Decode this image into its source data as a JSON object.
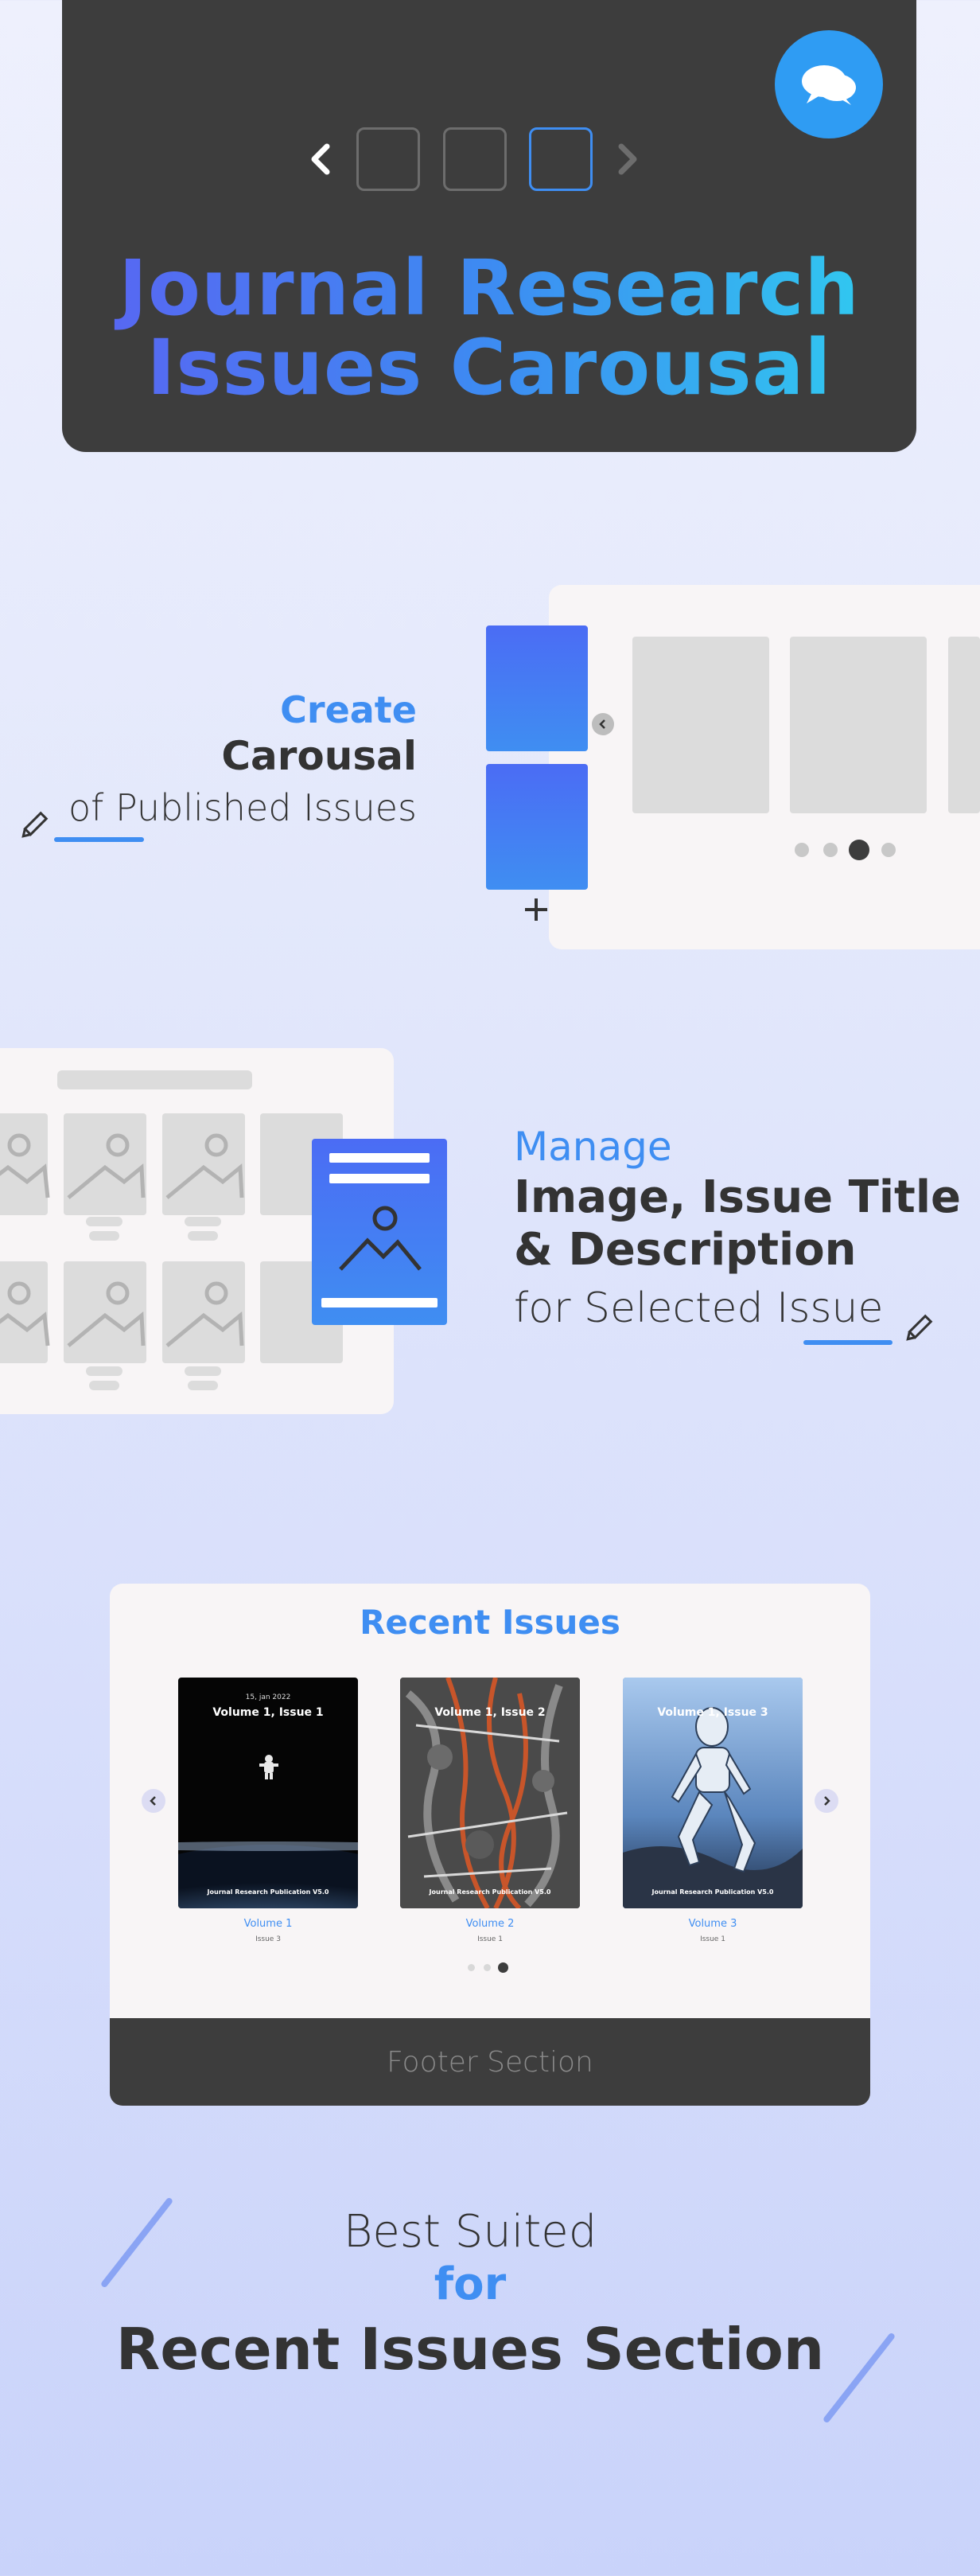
{
  "hero": {
    "title_line1": "Journal Research",
    "title_line2": "Issues Carousal"
  },
  "feature_create": {
    "accent": "Create",
    "main": "Carousal",
    "sub": "of Published Issues"
  },
  "feature_manage": {
    "accent": "Manage",
    "main_line1": "Image, Issue Title",
    "main_line2": "& Description",
    "sub": "for Selected Issue"
  },
  "recent_issues": {
    "title": "Recent Issues",
    "items": [
      {
        "date": "15, jan 2022",
        "cover_title": "Volume 1, Issue 1",
        "publication": "Journal Research Publication V5.0",
        "volume": "Volume 1",
        "issue": "Issue 3"
      },
      {
        "date": "",
        "cover_title": "Volume 1, Issue 2",
        "publication": "Journal Research Publication V5.0",
        "volume": "Volume 2",
        "issue": "Issue 1"
      },
      {
        "date": "",
        "cover_title": "Volume 1, Issue 3",
        "publication": "Journal Research Publication V5.0",
        "volume": "Volume 3",
        "issue": "Issue 1"
      }
    ],
    "footer": "Footer Section"
  },
  "closing": {
    "line1": "Best  Suited",
    "line2": "for",
    "line3": "Recent Issues Section"
  },
  "colors": {
    "accent": "#3f8ef2",
    "dark": "#3d3d3d",
    "chat_button": "#2f9cf3"
  }
}
